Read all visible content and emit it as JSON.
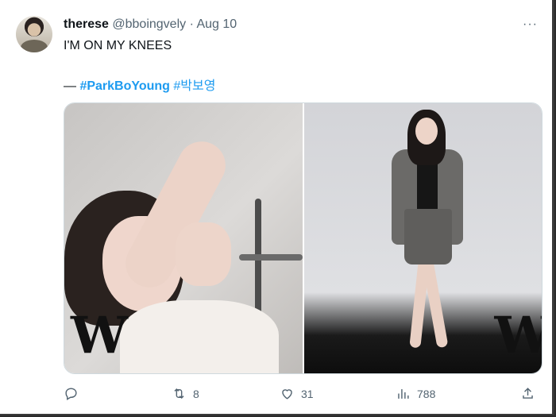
{
  "tweet": {
    "display_name": "therese",
    "handle": "@bboingvely",
    "separator": "·",
    "date": "Aug 10",
    "more_label": "···",
    "text": "I'M ON MY KNEES",
    "tags_prefix": "—",
    "hashtag1": "#ParkBoYoung",
    "hashtag2": "#박보영"
  },
  "media": {
    "left_logo": "W",
    "right_logo": "W"
  },
  "actions": {
    "reply_count": "",
    "retweet_count": "8",
    "like_count": "31",
    "views_count": "788"
  }
}
